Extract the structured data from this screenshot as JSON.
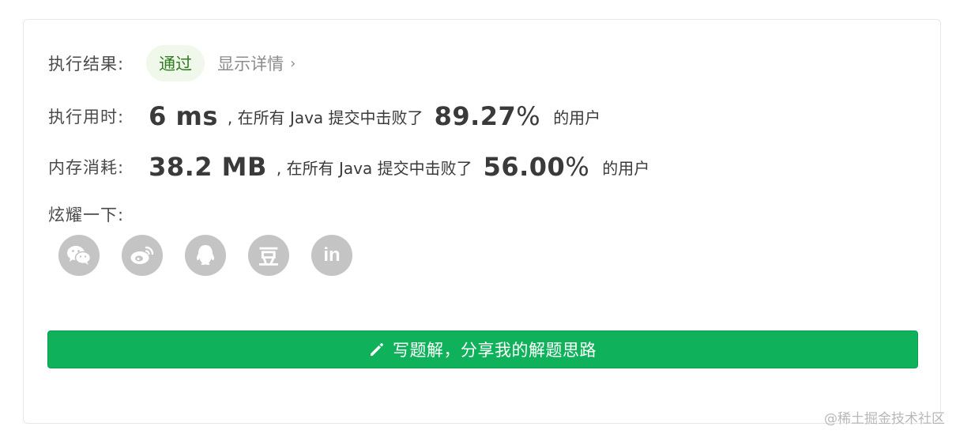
{
  "result": {
    "label": "执行结果:",
    "status": "通过",
    "details_link": "显示详情",
    "details_chevron": "›"
  },
  "runtime": {
    "label": "执行用时:",
    "value": "6 ms",
    "middle_text": ", 在所有 Java 提交中击败了",
    "percent": "89.27",
    "percent_sign": "%",
    "suffix": "的用户"
  },
  "memory": {
    "label": "内存消耗:",
    "value": "38.2 MB",
    "middle_text": ", 在所有 Java 提交中击败了",
    "percent": "56.00",
    "percent_sign": "%",
    "suffix": "的用户"
  },
  "share": {
    "label": "炫耀一下:",
    "icons": [
      "wechat-icon",
      "weibo-icon",
      "qq-icon",
      "douban-icon",
      "linkedin-icon"
    ],
    "douban_glyph": "豆",
    "linkedin_glyph": "in"
  },
  "write_button": {
    "label": "写题解，分享我的解题思路",
    "icon": "pencil-icon"
  },
  "watermark": "@稀土掘金技术社区",
  "colors": {
    "primary_green": "#0fb25a",
    "badge_bg": "#f0f8ec",
    "badge_text": "#2e7d1e",
    "share_icon_bg": "#c4c4c4"
  }
}
